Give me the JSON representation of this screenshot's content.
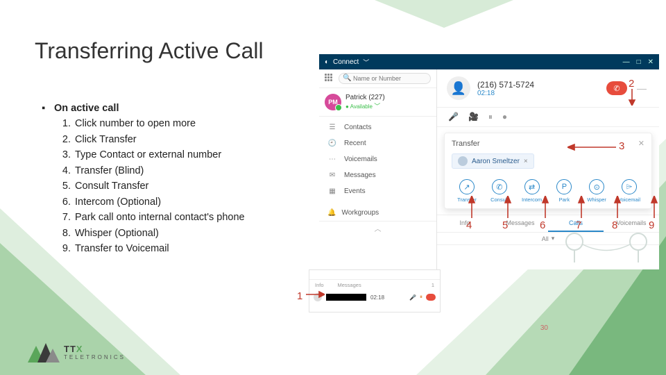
{
  "title": "Transferring Active Call",
  "bullet_lead": "On active call",
  "steps": [
    "Click number to open more",
    "Click Transfer",
    "Type Contact or external number",
    "Transfer (Blind)",
    "Consult Transfer",
    "Intercom (Optional)",
    "Park call onto internal contact's phone",
    "Whisper (Optional)",
    "Transfer to Voicemail"
  ],
  "app": {
    "title": "Connect",
    "search_placeholder": "Name or Number",
    "presence": {
      "initials": "PM",
      "name": "Patrick (227)",
      "status": "Available"
    },
    "nav": [
      "Contacts",
      "Recent",
      "Voicemails",
      "Messages",
      "Events"
    ],
    "workgroups_label": "Workgroups",
    "call": {
      "number": "(216) 571-5724",
      "duration": "02:18"
    },
    "transfer_label": "Transfer",
    "chip_name": "Aaron Smeltzer",
    "actions": [
      "Transfer",
      "Consult",
      "Intercom",
      "Park",
      "Whisper",
      "Voicemail"
    ],
    "tabs": [
      "Info",
      "Messages",
      "Calls",
      "Voicemails"
    ],
    "tabs_active": "Calls",
    "all_label": "All"
  },
  "mini": {
    "tabs": [
      "Info",
      "Messages"
    ],
    "count": "1",
    "time": "02:18"
  },
  "callouts": {
    "c1": "1",
    "c2": "2",
    "c3": "3",
    "c4": "4",
    "c5": "5",
    "c6": "6",
    "c7": "7",
    "c8": "8",
    "c9": "9"
  },
  "page_number": "30",
  "logo_text": "TELETRONICS"
}
